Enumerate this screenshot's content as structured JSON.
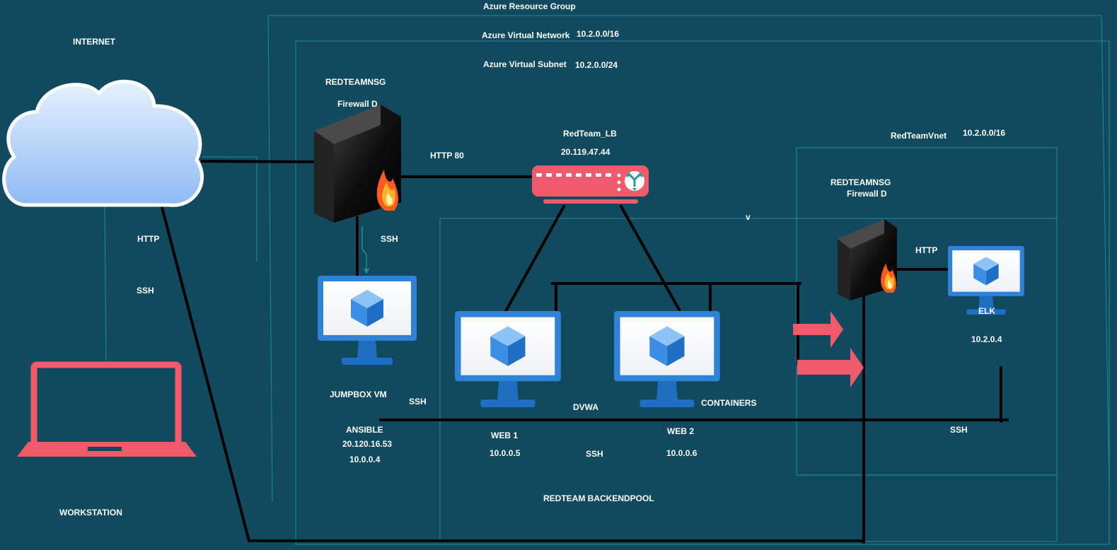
{
  "colors": {
    "background": "#114a5e",
    "boundary": "#1e8c99",
    "wire": "#000000",
    "monitor_blue": "#2f82d6",
    "cloud_fill": "#a8ccf7",
    "laptop": "#f05a6a",
    "arrow": "#f05a6a",
    "router": "#f05a6a",
    "label": "#ffffff"
  },
  "labels": {
    "resource_group": "Azure Resource Group",
    "virtual_network": "Azure Virtual Network",
    "virtual_network_cidr": "10.2.0.0/16",
    "virtual_subnet": "Azure Virtual Subnet",
    "virtual_subnet_cidr": "10.2.0.0/24",
    "internet": "INTERNET",
    "workstation": "WORKSTATION",
    "left_http": "HTTP",
    "left_ssh": "SSH",
    "nsg_title": "REDTEAMNSG",
    "nsg_firewall": "Firewall D",
    "http_80": "HTTP 80",
    "lb_name": "RedTeam_LB",
    "lb_ip": "20.119.47.44",
    "jumpbox_ssh": "SSH",
    "jumpbox_name": "JUMPBOX VM",
    "jumpbox_ssh_right": "SSH",
    "ansible": "ANSIBLE",
    "ansible_public_ip": "20.120.16.53",
    "ansible_private_ip": "10.0.0.4",
    "dvwa": "DVWA",
    "containers": "CONTAINERS",
    "web1": "WEB 1",
    "web1_ip": "10.0.0.5",
    "web2": "WEB 2",
    "web2_ip": "10.0.0.6",
    "backend_ssh": "SSH",
    "backend_pool": "REDTEAM BACKENDPOOL",
    "vnet2_name": "RedTeamVnet",
    "vnet2_cidr": "10.2.0.0/16",
    "nsg2_title": "REDTEAMNSG",
    "nsg2_firewall": "Firewall D",
    "v_mark": "v",
    "elk_http": "HTTP",
    "elk_name": "ELK",
    "elk_ip": "10.2.0.4",
    "elk_ssh": "SSH"
  },
  "icons": [
    "cloud-icon",
    "laptop-icon",
    "firewall-icon",
    "load-balancer-icon",
    "virtual-machine-icon",
    "arrow-right-icon"
  ]
}
